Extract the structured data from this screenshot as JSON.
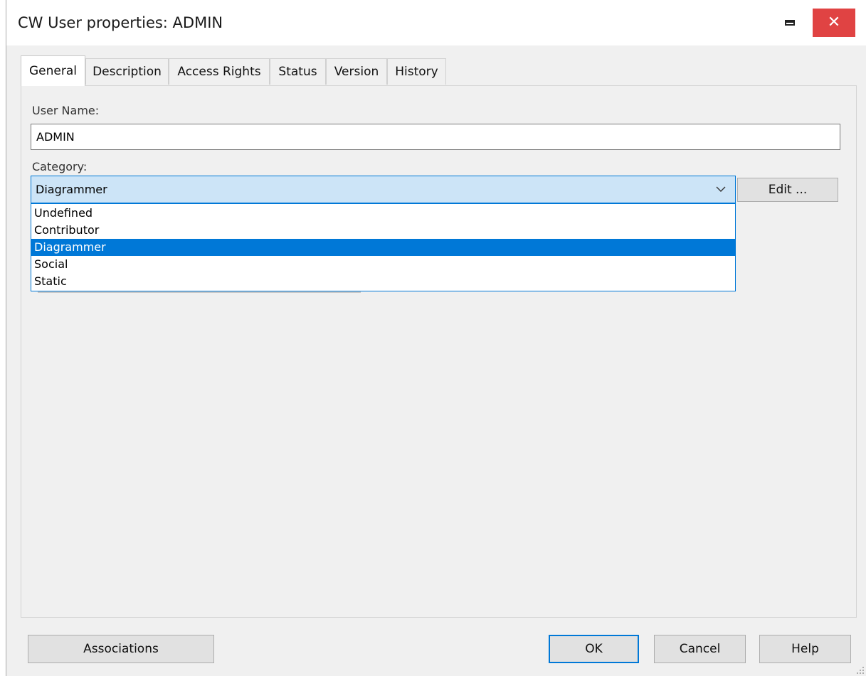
{
  "window": {
    "title": "CW User properties: ADMIN",
    "close_glyph": "✕"
  },
  "tabs": [
    {
      "label": "General",
      "active": true
    },
    {
      "label": "Description",
      "active": false
    },
    {
      "label": "Access Rights",
      "active": false
    },
    {
      "label": "Status",
      "active": false
    },
    {
      "label": "Version",
      "active": false
    },
    {
      "label": "History",
      "active": false
    }
  ],
  "general": {
    "user_name_label": "User Name:",
    "user_name_value": "ADMIN",
    "category_label": "Category:",
    "category_value": "Diagrammer",
    "edit_button": "Edit ...",
    "category_options": [
      {
        "label": "Undefined",
        "selected": false
      },
      {
        "label": "Contributor",
        "selected": false
      },
      {
        "label": "Diagrammer",
        "selected": true
      },
      {
        "label": "Social",
        "selected": false
      },
      {
        "label": "Static",
        "selected": false
      }
    ]
  },
  "footer": {
    "associations": "Associations",
    "ok": "OK",
    "cancel": "Cancel",
    "help": "Help"
  },
  "colors": {
    "accent": "#0078d7",
    "close_button": "#e04343",
    "combo_highlight": "#cce4f7"
  }
}
